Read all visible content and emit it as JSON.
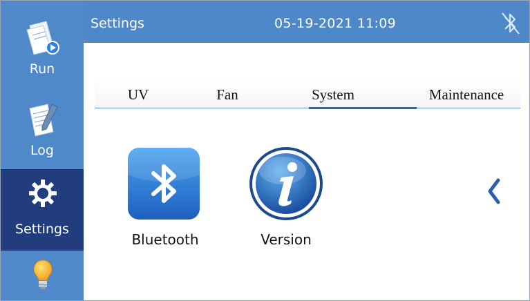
{
  "sidebar": {
    "items": [
      {
        "label": "Run",
        "icon": "run-book-icon"
      },
      {
        "label": "Log",
        "icon": "log-notepad-icon"
      },
      {
        "label": "Settings",
        "icon": "gear-icon",
        "active": true
      },
      {
        "label": "",
        "icon": "lightbulb-icon"
      }
    ]
  },
  "header": {
    "title": "Settings",
    "datetime": "05-19-2021 11:09",
    "status_icon": "bluetooth-disabled-icon"
  },
  "tabs": [
    {
      "label": "UV"
    },
    {
      "label": "Fan"
    },
    {
      "label": "System",
      "selected": true
    },
    {
      "label": "Maintenance"
    }
  ],
  "content": {
    "tiles": [
      {
        "label": "Bluetooth",
        "icon": "bluetooth-icon"
      },
      {
        "label": "Version",
        "icon": "info-icon"
      }
    ],
    "nav_icon": "chevron-left-icon"
  },
  "colors": {
    "sidebar": "#5089c9",
    "sidebar_active": "#223d7e",
    "header": "#4f88c8",
    "tab_indicator": "#2a66b2"
  }
}
